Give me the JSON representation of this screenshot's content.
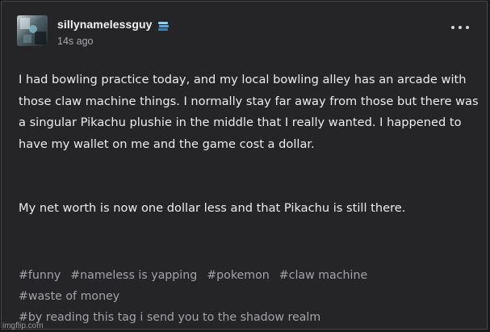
{
  "post": {
    "username": "sillynamelessguy",
    "timestamp": "14s ago",
    "avatar_icon": "blurry-photo-avatar",
    "badge_icon": "blue-stack-badge-icon",
    "more_icon": "ellipsis-icon",
    "paragraphs": [
      "I had bowling practice today, and my local bowling alley has an arcade with those claw machine things. I normally stay far away from those but there was a singular Pikachu plushie in the middle that I really wanted. I happened to have my wallet on me and the game cost a dollar.",
      "My net worth is now one dollar less and that Pikachu is still there."
    ],
    "tags": [
      [
        "#funny",
        "#nameless is yapping",
        "#pokemon",
        "#claw machine"
      ],
      [
        "#waste of money"
      ],
      [
        "#by reading this tag i send you to the shadow realm"
      ]
    ]
  },
  "watermark": "imgflip.com",
  "colors": {
    "background": "#252528",
    "border": "#48484c",
    "text": "#ececec",
    "tag_text": "#a3a3a8",
    "muted": "#a9a9ad",
    "badge_blue": "#5aa9d8"
  }
}
